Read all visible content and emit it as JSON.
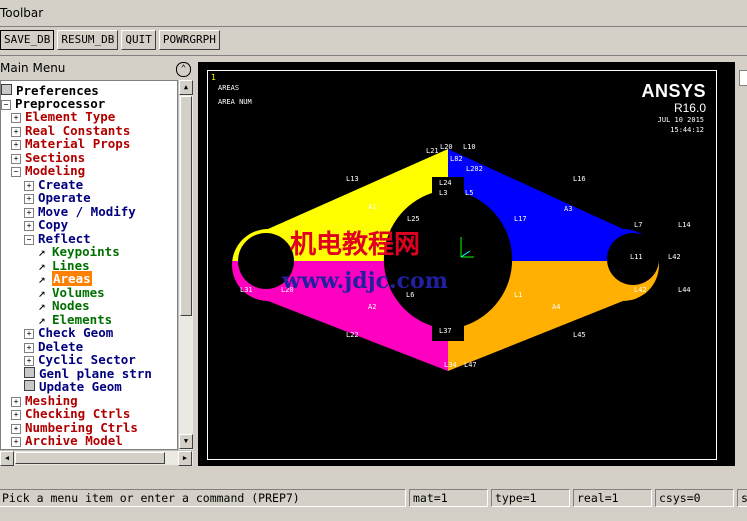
{
  "toolbar": {
    "title": "Toolbar",
    "buttons": [
      "SAVE_DB",
      "RESUM_DB",
      "QUIT",
      "POWRGRPH"
    ]
  },
  "main_menu": {
    "title": "Main Menu",
    "items": [
      {
        "label": "Preferences",
        "color": "#000000"
      },
      {
        "label": "Preprocessor",
        "color": "#000000"
      },
      {
        "label": "Element Type",
        "color": "#b00000"
      },
      {
        "label": "Real Constants",
        "color": "#b00000"
      },
      {
        "label": "Material Props",
        "color": "#b00000"
      },
      {
        "label": "Sections",
        "color": "#b00000"
      },
      {
        "label": "Modeling",
        "color": "#b00000"
      },
      {
        "label": "Create",
        "color": "#00007f"
      },
      {
        "label": "Operate",
        "color": "#00007f"
      },
      {
        "label": "Move / Modify",
        "color": "#00007f"
      },
      {
        "label": "Copy",
        "color": "#00007f"
      },
      {
        "label": "Reflect",
        "color": "#00007f"
      },
      {
        "label": "Keypoints",
        "color": "#007000"
      },
      {
        "label": "Lines",
        "color": "#007000"
      },
      {
        "label": "Areas",
        "color": "#ff8000"
      },
      {
        "label": "Volumes",
        "color": "#007000"
      },
      {
        "label": "Nodes",
        "color": "#007000"
      },
      {
        "label": "Elements",
        "color": "#007000"
      },
      {
        "label": "Check Geom",
        "color": "#00007f"
      },
      {
        "label": "Delete",
        "color": "#00007f"
      },
      {
        "label": "Cyclic Sector",
        "color": "#00007f"
      },
      {
        "label": "Genl plane strn",
        "color": "#00007f"
      },
      {
        "label": "Update Geom",
        "color": "#00007f"
      },
      {
        "label": "Meshing",
        "color": "#b00000"
      },
      {
        "label": "Checking Ctrls",
        "color": "#b00000"
      },
      {
        "label": "Numbering Ctrls",
        "color": "#b00000"
      },
      {
        "label": "Archive Model",
        "color": "#b00000"
      }
    ]
  },
  "graphics": {
    "window_number": "1",
    "plot_title": "AREAS",
    "plot_subtitle": "AREA NUM",
    "logo": "ANSYS",
    "release": "R16.0",
    "date": "JUL 10 2015",
    "time": "15:44:12",
    "colors": {
      "area1": "#ffff00",
      "area2": "#ff00c0",
      "area3": "#0000ff",
      "area4": "#ffb000"
    },
    "labels": [
      "L21",
      "L20",
      "L10",
      "L82",
      "L202",
      "L13",
      "L16",
      "L24",
      "L3",
      "L5",
      "A1",
      "A3",
      "L7",
      "L14",
      "L17",
      "L25",
      "L20",
      "L42",
      "L44",
      "L31",
      "A2",
      "L1",
      "A4",
      "L22",
      "L37",
      "L6",
      "L45",
      "L34",
      "L47",
      "L11",
      "L42"
    ],
    "watermark_cn": "机电教程网",
    "watermark_url": "www.jdjc.com"
  },
  "status": {
    "prompt": "Pick a menu item or enter a command (PREP7)",
    "mat": "mat=1",
    "type": "type=1",
    "real": "real=1",
    "csys": "csys=0",
    "extra": "se"
  }
}
